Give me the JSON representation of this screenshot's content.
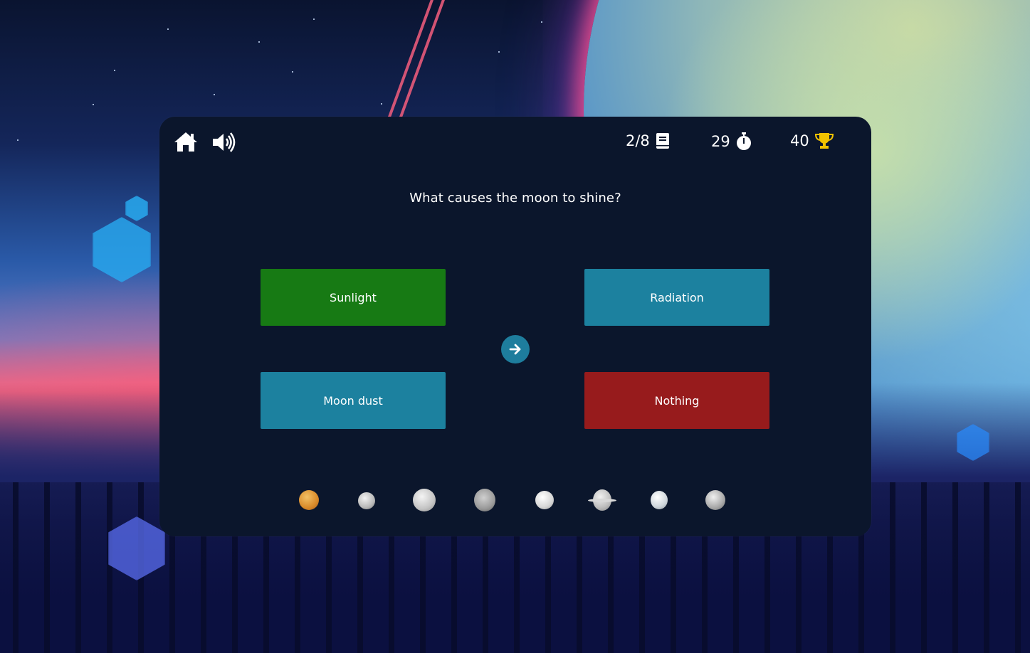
{
  "hud": {
    "question_progress": "2/8",
    "timer": "29",
    "score": "40"
  },
  "question": {
    "text": "What causes the moon to shine?"
  },
  "answers": [
    {
      "label": "Sunlight",
      "state": "correct",
      "color": "#177a14"
    },
    {
      "label": "Radiation",
      "state": "neutral",
      "color": "#1c819f"
    },
    {
      "label": "Moon dust",
      "state": "neutral",
      "color": "#1c819f"
    },
    {
      "label": "Nothing",
      "state": "wrong",
      "color": "#971b1c"
    }
  ],
  "icons": {
    "home": "home-icon",
    "sound": "speaker-icon",
    "questions": "book-icon",
    "timer": "stopwatch-icon",
    "score": "trophy-icon",
    "next": "arrow-right-icon"
  },
  "planet_tracker": [
    "venus",
    "mercury",
    "moon",
    "rocky-moon",
    "white-moon",
    "saturn",
    "ice-moon",
    "grey-planet"
  ],
  "colors": {
    "panel": "#0b162c",
    "accent": "#1e7d9d",
    "trophy": "#f2c200"
  }
}
